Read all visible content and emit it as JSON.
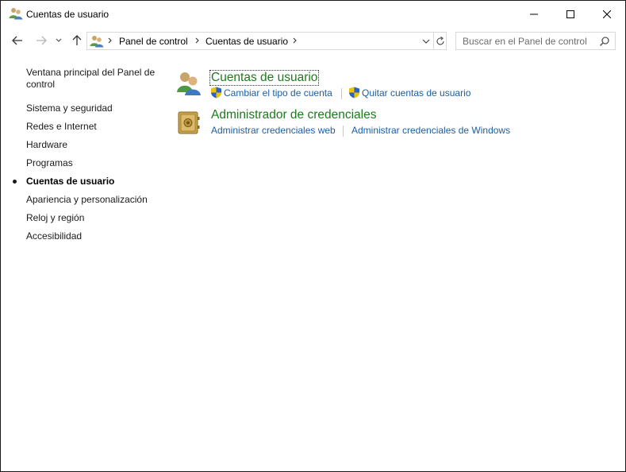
{
  "window": {
    "title": "Cuentas de usuario"
  },
  "address_bar": {
    "crumbs": [
      "Panel de control",
      "Cuentas de usuario"
    ]
  },
  "search": {
    "placeholder": "Buscar en el Panel de control"
  },
  "sidebar": {
    "home_link": "Ventana principal del Panel de control",
    "items": [
      {
        "label": "Sistema y seguridad",
        "active": false
      },
      {
        "label": "Redes e Internet",
        "active": false
      },
      {
        "label": "Hardware",
        "active": false
      },
      {
        "label": "Programas",
        "active": false
      },
      {
        "label": "Cuentas de usuario",
        "active": true
      },
      {
        "label": "Apariencia y personalización",
        "active": false
      },
      {
        "label": "Reloj y región",
        "active": false
      },
      {
        "label": "Accesibilidad",
        "active": false
      }
    ]
  },
  "categories": [
    {
      "title": "Cuentas de usuario",
      "icon": "user-accounts-icon",
      "tasks": [
        {
          "label": "Cambiar el tipo de cuenta",
          "icon": "uac-shield-icon"
        },
        {
          "label": "Quitar cuentas de usuario",
          "icon": "uac-shield-icon"
        }
      ]
    },
    {
      "title": "Administrador de credenciales",
      "icon": "credential-manager-icon",
      "tasks": [
        {
          "label": "Administrar credenciales web"
        },
        {
          "label": "Administrar credenciales de Windows"
        }
      ]
    }
  ],
  "colors": {
    "category_title": "#1e7a1e",
    "task_link": "#1a5fa3",
    "shield_blue": "#2a62c9",
    "shield_yellow": "#f2c200"
  }
}
